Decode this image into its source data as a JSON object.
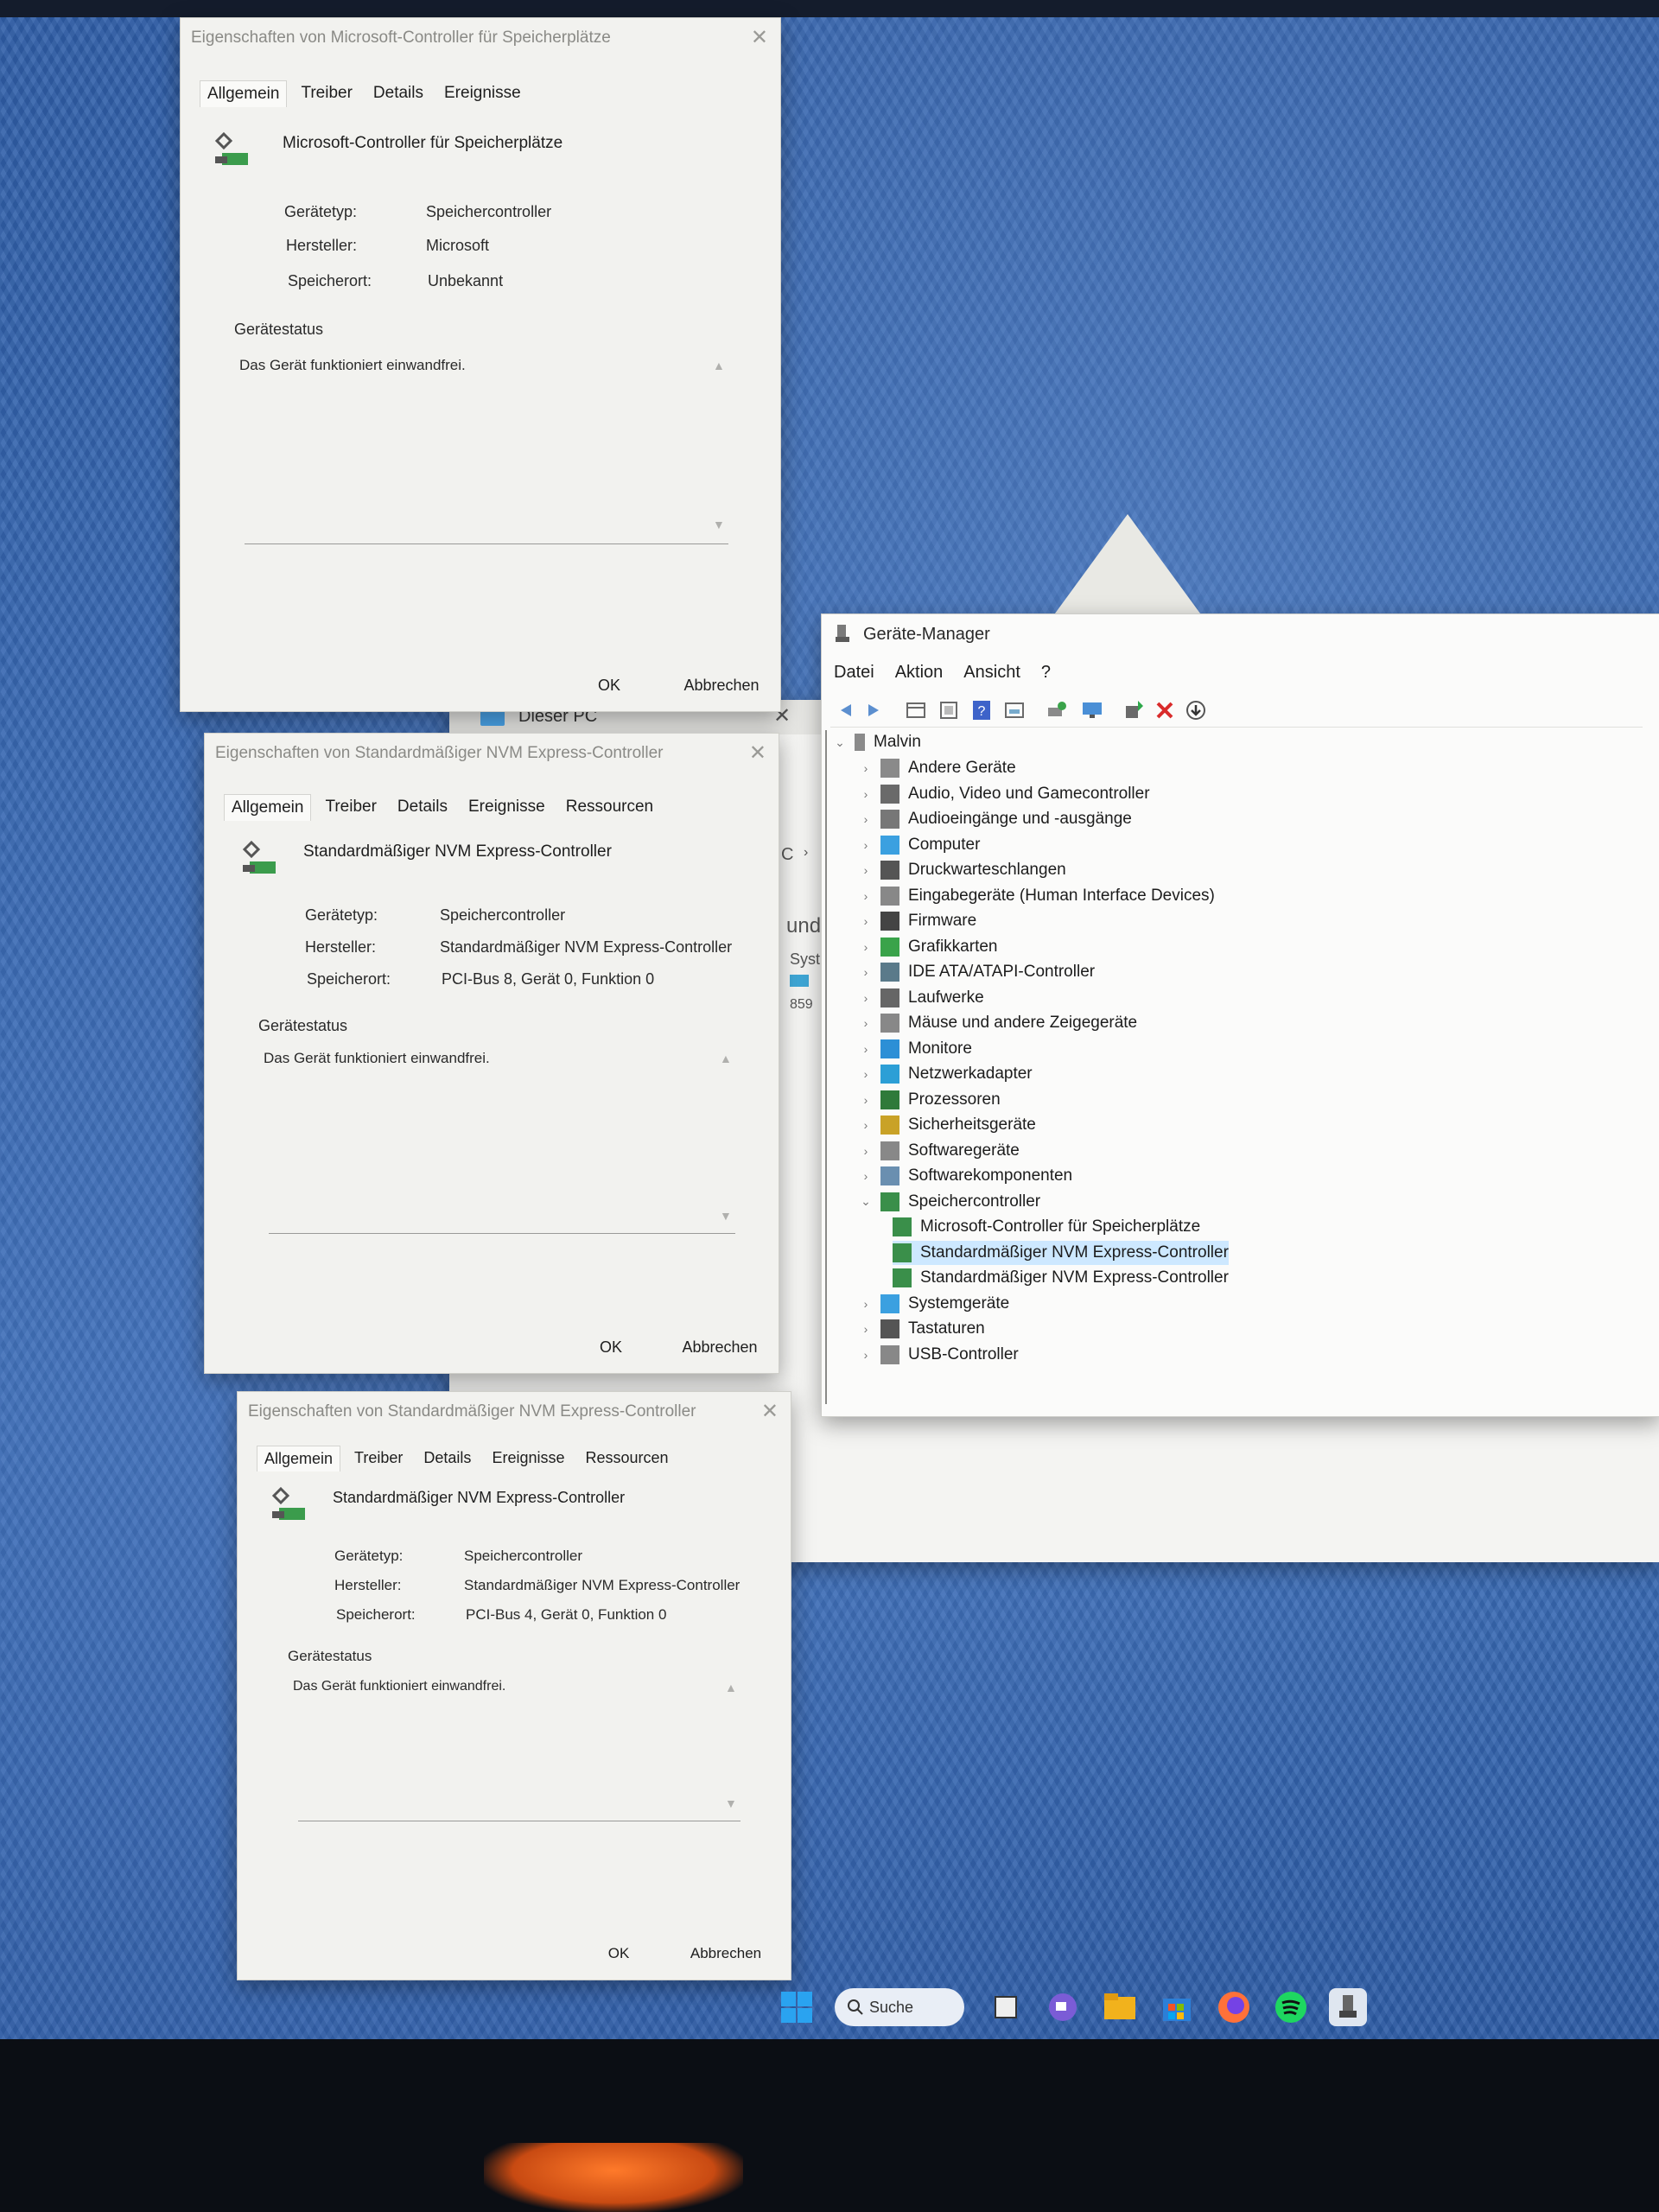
{
  "dialogs": [
    {
      "title": "Eigenschaften von Microsoft-Controller für Speicherplätze",
      "tabs": [
        "Allgemein",
        "Treiber",
        "Details",
        "Ereignisse"
      ],
      "device_name": "Microsoft-Controller für Speicherplätze",
      "labels": {
        "type": "Gerätetyp:",
        "manufacturer": "Hersteller:",
        "location": "Speicherort:"
      },
      "values": {
        "type": "Speichercontroller",
        "manufacturer": "Microsoft",
        "location": "Unbekannt"
      },
      "status_heading": "Gerätestatus",
      "status_text": "Das Gerät funktioniert einwandfrei.",
      "ok": "OK",
      "cancel": "Abbrechen"
    },
    {
      "title": "Eigenschaften von Standardmäßiger NVM Express-Controller",
      "tabs": [
        "Allgemein",
        "Treiber",
        "Details",
        "Ereignisse",
        "Ressourcen"
      ],
      "device_name": "Standardmäßiger NVM Express-Controller",
      "labels": {
        "type": "Gerätetyp:",
        "manufacturer": "Hersteller:",
        "location": "Speicherort:"
      },
      "values": {
        "type": "Speichercontroller",
        "manufacturer": "Standardmäßiger NVM Express-Controller",
        "location": "PCI-Bus 8, Gerät 0, Funktion 0"
      },
      "status_heading": "Gerätestatus",
      "status_text": "Das Gerät funktioniert einwandfrei.",
      "ok": "OK",
      "cancel": "Abbrechen"
    },
    {
      "title": "Eigenschaften von Standardmäßiger NVM Express-Controller",
      "tabs": [
        "Allgemein",
        "Treiber",
        "Details",
        "Ereignisse",
        "Ressourcen"
      ],
      "device_name": "Standardmäßiger NVM Express-Controller",
      "labels": {
        "type": "Gerätetyp:",
        "manufacturer": "Hersteller:",
        "location": "Speicherort:"
      },
      "values": {
        "type": "Speichercontroller",
        "manufacturer": "Standardmäßiger NVM Express-Controller",
        "location": "PCI-Bus 4, Gerät 0, Funktion 0"
      },
      "status_heading": "Gerätestatus",
      "status_text": "Das Gerät funktioniert einwandfrei.",
      "ok": "OK",
      "cancel": "Abbrechen"
    }
  ],
  "explorer": {
    "title": "Dieser PC",
    "fragments": [
      "C",
      "und",
      "Syst",
      "859"
    ]
  },
  "device_manager": {
    "title": "Geräte-Manager",
    "menu": [
      "Datei",
      "Aktion",
      "Ansicht",
      "?"
    ],
    "toolbar_icons": [
      "back-icon",
      "forward-icon",
      "properties-icon",
      "view-icon",
      "help-icon",
      "devices-icon",
      "scan-icon",
      "monitor-icon",
      "update-driver-icon",
      "uninstall-icon",
      "download-icon"
    ],
    "root": "Malvin",
    "categories": [
      "Andere Geräte",
      "Audio, Video und Gamecontroller",
      "Audioeingänge und -ausgänge",
      "Computer",
      "Druckwarteschlangen",
      "Eingabegeräte (Human Interface Devices)",
      "Firmware",
      "Grafikkarten",
      "IDE ATA/ATAPI-Controller",
      "Laufwerke",
      "Mäuse und andere Zeigegeräte",
      "Monitore",
      "Netzwerkadapter",
      "Prozessoren",
      "Sicherheitsgeräte",
      "Softwaregeräte",
      "Softwarekomponenten",
      "Speichercontroller"
    ],
    "storage_children": [
      "Microsoft-Controller für Speicherplätze",
      "Standardmäßiger NVM Express-Controller",
      "Standardmäßiger NVM Express-Controller"
    ],
    "categories_after": [
      "Systemgeräte",
      "Tastaturen",
      "USB-Controller"
    ]
  },
  "taskbar": {
    "search_label": "Suche",
    "icons": [
      "start-icon",
      "search-icon",
      "task-view-icon",
      "chat-icon",
      "file-explorer-icon",
      "store-icon",
      "firefox-icon",
      "spotify-icon",
      "device-manager-icon"
    ]
  },
  "colors": {
    "wallpaper": "#3566b0",
    "selection": "#cde8ff",
    "uninstall_red": "#d92b2b"
  }
}
